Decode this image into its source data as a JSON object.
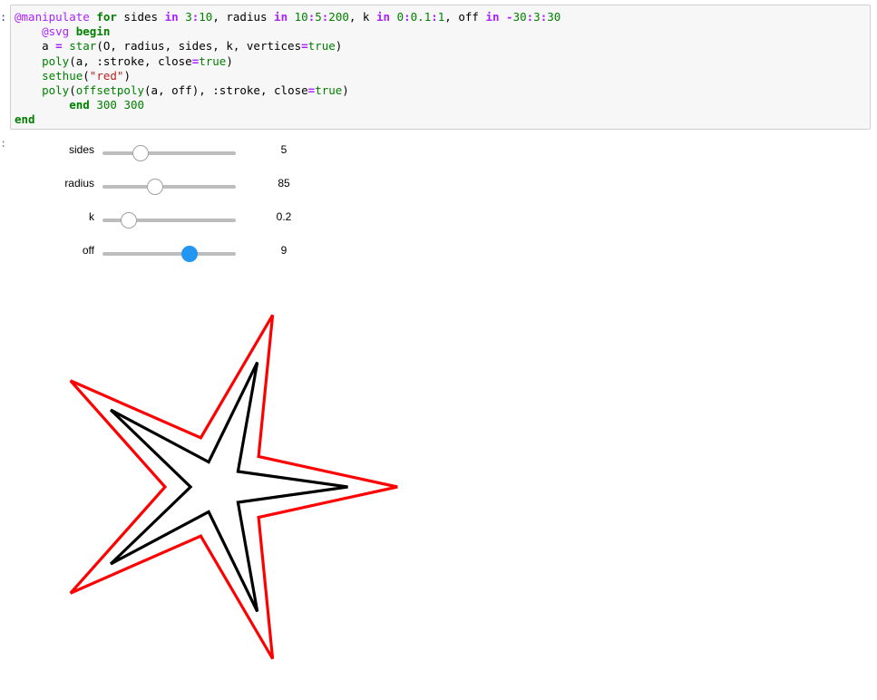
{
  "cell": {
    "prompt": ":",
    "output_prompt": ":",
    "code_lines": [
      [
        [
          "mac",
          "@manipulate"
        ],
        [
          "t",
          " "
        ],
        [
          "kw",
          "for"
        ],
        [
          "t",
          " sides "
        ],
        [
          "op",
          "in"
        ],
        [
          "t",
          " "
        ],
        [
          "num",
          "3"
        ],
        [
          "op",
          ":"
        ],
        [
          "num",
          "10"
        ],
        [
          "t",
          ", radius "
        ],
        [
          "op",
          "in"
        ],
        [
          "t",
          " "
        ],
        [
          "num",
          "10"
        ],
        [
          "op",
          ":"
        ],
        [
          "num",
          "5"
        ],
        [
          "op",
          ":"
        ],
        [
          "num",
          "200"
        ],
        [
          "t",
          ", k "
        ],
        [
          "op",
          "in"
        ],
        [
          "t",
          " "
        ],
        [
          "num",
          "0"
        ],
        [
          "op",
          ":"
        ],
        [
          "num",
          "0.1"
        ],
        [
          "op",
          ":"
        ],
        [
          "num",
          "1"
        ],
        [
          "t",
          ", off "
        ],
        [
          "op",
          "in"
        ],
        [
          "t",
          " "
        ],
        [
          "op",
          "-"
        ],
        [
          "num",
          "30"
        ],
        [
          "op",
          ":"
        ],
        [
          "num",
          "3"
        ],
        [
          "op",
          ":"
        ],
        [
          "num",
          "30"
        ]
      ],
      [
        [
          "t",
          "    "
        ],
        [
          "mac",
          "@svg"
        ],
        [
          "t",
          " "
        ],
        [
          "kw",
          "begin"
        ]
      ],
      [
        [
          "t",
          "    a "
        ],
        [
          "op",
          "="
        ],
        [
          "t",
          " "
        ],
        [
          "fn",
          "star"
        ],
        [
          "t",
          "(O, radius, sides, k, vertices"
        ],
        [
          "op",
          "="
        ],
        [
          "num",
          "true"
        ],
        [
          "t",
          ")"
        ]
      ],
      [
        [
          "t",
          "    "
        ],
        [
          "fn",
          "poly"
        ],
        [
          "t",
          "(a, "
        ],
        [
          "sym",
          ":stroke"
        ],
        [
          "t",
          ", close"
        ],
        [
          "op",
          "="
        ],
        [
          "num",
          "true"
        ],
        [
          "t",
          ")"
        ]
      ],
      [
        [
          "t",
          "    "
        ],
        [
          "fn",
          "sethue"
        ],
        [
          "t",
          "("
        ],
        [
          "str",
          "\"red\""
        ],
        [
          "t",
          ")"
        ]
      ],
      [
        [
          "t",
          "    "
        ],
        [
          "fn",
          "poly"
        ],
        [
          "t",
          "("
        ],
        [
          "fn",
          "offsetpoly"
        ],
        [
          "t",
          "(a, off), "
        ],
        [
          "sym",
          ":stroke"
        ],
        [
          "t",
          ", close"
        ],
        [
          "op",
          "="
        ],
        [
          "num",
          "true"
        ],
        [
          "t",
          ")"
        ]
      ],
      [
        [
          "t",
          "        "
        ],
        [
          "kw",
          "end"
        ],
        [
          "t",
          " "
        ],
        [
          "num",
          "300"
        ],
        [
          "t",
          " "
        ],
        [
          "num",
          "300"
        ]
      ],
      [
        [
          "kw",
          "end"
        ]
      ]
    ]
  },
  "sliders": [
    {
      "name": "sides",
      "label": "sides",
      "min": 3,
      "max": 10,
      "value": 5,
      "display": "5",
      "active": false
    },
    {
      "name": "radius",
      "label": "radius",
      "min": 10,
      "max": 200,
      "value": 85,
      "display": "85",
      "active": false
    },
    {
      "name": "k",
      "label": "k",
      "min": 0,
      "max": 1,
      "value": 0.2,
      "display": "0.2",
      "active": false
    },
    {
      "name": "off",
      "label": "off",
      "min": -30,
      "max": 30,
      "value": 9,
      "display": "9",
      "active": true
    }
  ],
  "colors": {
    "inner_stroke": "#000000",
    "offset_stroke": "#ff0000",
    "slider_active": "#2196f3"
  }
}
